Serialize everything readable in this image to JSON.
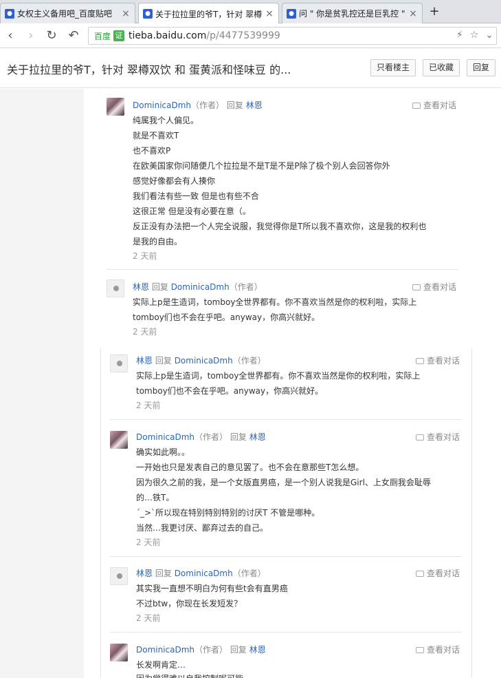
{
  "browser": {
    "tabs": [
      {
        "label": "女权主义备用吧_百度贴吧"
      },
      {
        "label": "关于拉拉里的爷T，针对 翠樽"
      },
      {
        "label": "问 \" 你是贫乳控还是巨乳控 \""
      }
    ],
    "url_badge": "百度",
    "url_cert": "证",
    "url_host": "tieba.baidu.com",
    "url_path": "/p/4477539999"
  },
  "page": {
    "title": "关于拉拉里的爷T，针对 翠樽双饮 和 蛋黄派和怪味豆 的...",
    "btn_only_op": "只看楼主",
    "btn_fav": "已收藏",
    "btn_reply": "回复"
  },
  "labels": {
    "author_tag": "（作者）",
    "reply_word": "回复",
    "view_conv": "查看对话",
    "time": "2 天前"
  },
  "replies": [
    {
      "author": "DominicaDmh",
      "target": "林恩",
      "lines": [
        "纯属我个人偏见。",
        "就是不喜欢T",
        "也不喜欢P",
        "在欧美国家你问随便几个拉拉是不是T是不是P除了极个别人会回答你外",
        "感觉好像都会有人揍你",
        "我们看法有些一致 但是也有些不合",
        "这很正常 但是没有必要在意（。",
        "反正没有办法把一个人完全说服，我觉得你是T所以我不喜欢你，这是我的权利也",
        "是我的自由。"
      ]
    },
    {
      "author": "林恩",
      "target": "DominicaDmh",
      "lines": [
        "实际上p是生造词，tomboy全世界都有。你不喜欢当然是你的权利啦，实际上",
        "tomboy们也不会在乎吧。anyway，你高兴就好。"
      ]
    },
    {
      "author": "林恩",
      "target": "DominicaDmh",
      "lines": [
        "实际上p是生造词，tomboy全世界都有。你不喜欢当然是你的权利啦，实际上",
        "tomboy们也不会在乎吧。anyway，你高兴就好。"
      ]
    },
    {
      "author": "DominicaDmh",
      "target": "林恩",
      "lines": [
        "确实如此啊。。",
        "一开始也只是发表自己的意见罢了。也不会在意那些T怎么想。",
        "因为很久之前的我，是一个女版直男癌，是一个别人说我是Girl、上女厕我会耻辱",
        "的…铁T。",
        "´_>`所以现在特别特别特别的讨厌T 不管是哪种。",
        "当然…我更讨厌、鄙弃过去的自己。"
      ]
    },
    {
      "author": "林恩",
      "target": "DominicaDmh",
      "lines": [
        "其实我一直想不明白为何有些t会有直男癌",
        "不过btw，你现在长发短发？"
      ]
    },
    {
      "author": "DominicaDmh",
      "target": "林恩",
      "lines": [
        "长发啊肯定…",
        "因为觉得难以自我控制呢可能"
      ]
    }
  ]
}
